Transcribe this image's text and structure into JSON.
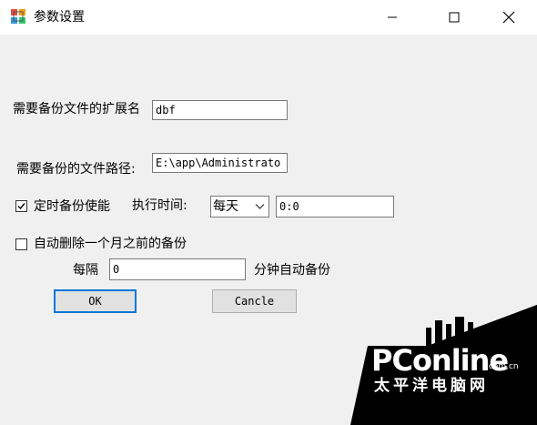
{
  "window": {
    "title": "参数设置"
  },
  "form": {
    "ext_label": "需要备份文件的扩展名",
    "ext_value": "dbf",
    "path_label": "需要备份的文件路径:",
    "path_value": "E:\\app\\Administrato",
    "timed_backup": {
      "label": "定时备份使能",
      "checked": true
    },
    "exec_time_label": "执行时间:",
    "frequency_selected": "每天",
    "time_value": "0:0",
    "auto_delete": {
      "label": "自动删除一个月之前的备份",
      "checked": false
    },
    "interval_prefix": "每隔",
    "interval_value": "0",
    "interval_suffix": "分钟自动备份"
  },
  "buttons": {
    "ok_label": "OK",
    "cancel_label": "Cancle"
  },
  "watermark": {
    "brand": "PConline",
    "dotcom": ".com.cn",
    "cn_name": "太平洋电脑网"
  },
  "colors": {
    "dialog_bg": "#f0f0f0",
    "accent": "#0078d7",
    "watermark_bg": "#000000"
  }
}
